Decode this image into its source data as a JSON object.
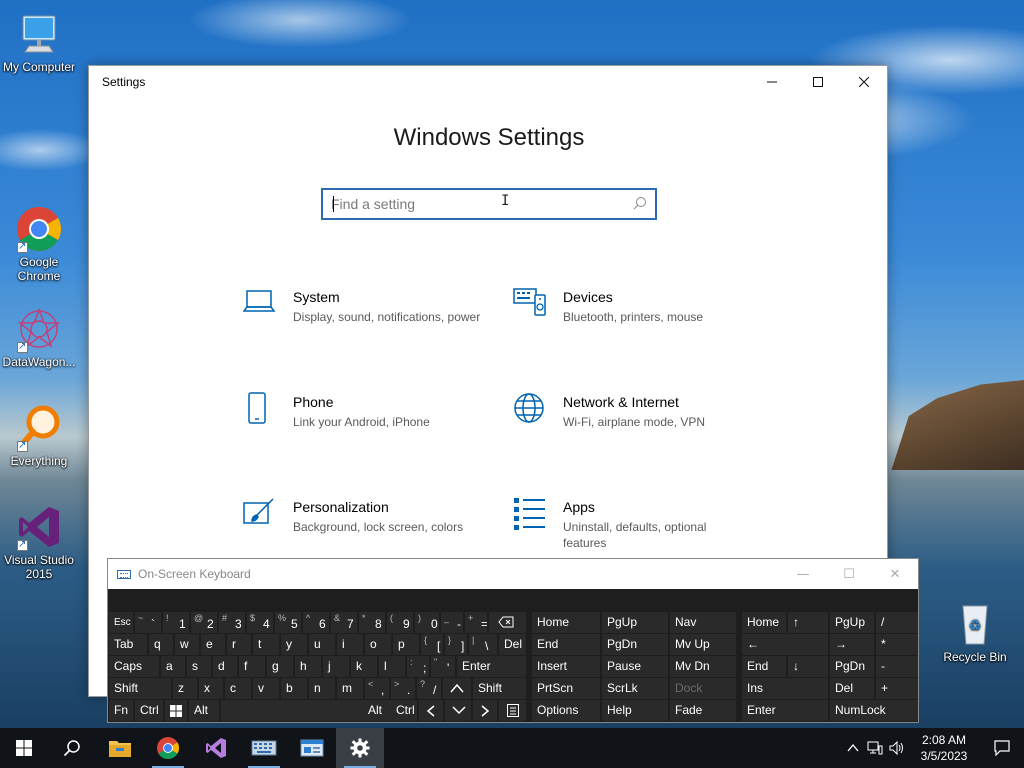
{
  "desktop": {
    "icons": [
      {
        "label": "My Computer"
      },
      {
        "label": "Google Chrome"
      },
      {
        "label": "DataWagon..."
      },
      {
        "label": "Everything"
      },
      {
        "label": "Visual Studio 2015"
      },
      {
        "label": "Recycle Bin"
      }
    ]
  },
  "settings": {
    "window_title": "Settings",
    "heading": "Windows Settings",
    "search_placeholder": "Find a setting",
    "tiles": [
      {
        "name": "System",
        "desc": "Display, sound, notifications, power",
        "icon": "laptop-icon"
      },
      {
        "name": "Devices",
        "desc": "Bluetooth, printers, mouse",
        "icon": "devices-icon"
      },
      {
        "name": "Phone",
        "desc": "Link your Android, iPhone",
        "icon": "phone-icon"
      },
      {
        "name": "Network & Internet",
        "desc": "Wi-Fi, airplane mode, VPN",
        "icon": "globe-icon"
      },
      {
        "name": "Personalization",
        "desc": "Background, lock screen, colors",
        "icon": "paintbrush-icon"
      },
      {
        "name": "Apps",
        "desc": "Uninstall, defaults, optional features",
        "icon": "apps-list-icon"
      }
    ],
    "accent_color": "#0063b1"
  },
  "osk": {
    "title": "On-Screen Keyboard",
    "keys": {
      "esc": "Esc",
      "tilde_sup": "~",
      "tilde": "`",
      "k1s": "!",
      "k1": "1",
      "k2s": "@",
      "k2": "2",
      "k3s": "#",
      "k3": "3",
      "k4s": "$",
      "k4": "4",
      "k5s": "%",
      "k5": "5",
      "k6s": "^",
      "k6": "6",
      "k7s": "&",
      "k7": "7",
      "k8s": "*",
      "k8": "8",
      "k9s": "(",
      "k9": "9",
      "k0s": ")",
      "k0": "0",
      "minus_s": "_",
      "minus": "-",
      "eq_s": "+",
      "eq": "=",
      "tab": "Tab",
      "q": "q",
      "w": "w",
      "e": "e",
      "r": "r",
      "t": "t",
      "y": "y",
      "u": "u",
      "i": "i",
      "o": "o",
      "p": "p",
      "lb_s": "{",
      "lb": "[",
      "rb_s": "}",
      "rb": "]",
      "bs_s": "|",
      "bs": "\\",
      "del": "Del",
      "caps": "Caps",
      "a": "a",
      "s": "s",
      "d": "d",
      "f": "f",
      "g": "g",
      "h": "h",
      "j": "j",
      "k": "k",
      "l": "l",
      "semi_s": ":",
      "semi": ";",
      "quote_s": "\"",
      "quote": "'",
      "enter": "Enter",
      "shift": "Shift",
      "z": "z",
      "x": "x",
      "c": "c",
      "v": "v",
      "b": "b",
      "n": "n",
      "m": "m",
      "comma_s": "<",
      "comma": ",",
      "period_s": ">",
      "period": ".",
      "slash_s": "?",
      "slash": "/",
      "shift_r": "Shift",
      "fn": "Fn",
      "ctrl": "Ctrl",
      "alt": "Alt",
      "alt_r": "Alt",
      "ctrl_r": "Ctrl",
      "home": "Home",
      "pgup": "PgUp",
      "nav": "Nav",
      "end": "End",
      "pgdn": "PgDn",
      "mvup": "Mv Up",
      "insert": "Insert",
      "pause": "Pause",
      "mvdn": "Mv Dn",
      "prtscn": "PrtScn",
      "scrlk": "ScrLk",
      "dock": "Dock",
      "options": "Options",
      "help": "Help",
      "fade": "Fade",
      "np_home": "Home",
      "np_pgup": "PgUp",
      "np_slash": "/",
      "np_star": "*",
      "np_end": "End",
      "np_pgdn": "PgDn",
      "np_minus": "-",
      "np_ins": "Ins",
      "np_del": "Del",
      "np_plus": "+",
      "np_enter": "Enter",
      "np_numlock": "NumLock"
    }
  },
  "taskbar": {
    "time": "2:08 AM",
    "date": "3/5/2023"
  }
}
